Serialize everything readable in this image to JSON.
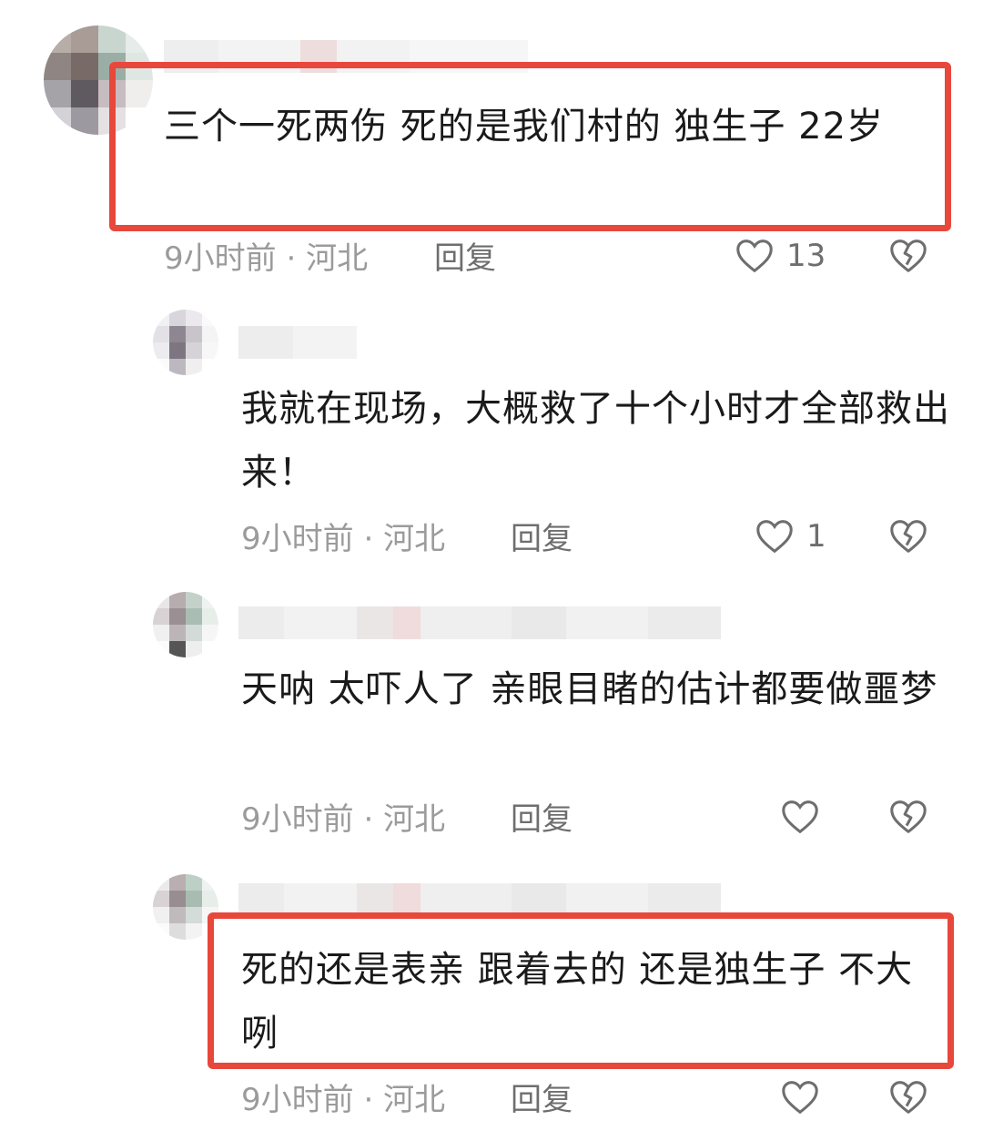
{
  "comments": [
    {
      "text": "三个一死两伤 死的是我们村的 独生子 22岁",
      "time": "9小时前",
      "location": "河北",
      "reply_label": "回复",
      "like_count": "13",
      "like_icon": "heart-outline-icon",
      "dislike_icon": "broken-heart-icon",
      "highlighted": true
    },
    {
      "text": "我就在现场，大概救了十个小时才全部救出来！",
      "time": "9小时前",
      "location": "河北",
      "reply_label": "回复",
      "like_count": "1",
      "highlighted": false
    },
    {
      "text": "天呐 太吓人了 亲眼目睹的估计都要做噩梦",
      "time": "9小时前",
      "location": "河北",
      "reply_label": "回复",
      "like_count": "",
      "highlighted": false
    },
    {
      "text": "死的还是表亲 跟着去的 还是独生子 不大咧",
      "time": "9小时前",
      "location": "河北",
      "reply_label": "回复",
      "like_count": "",
      "highlighted": true
    }
  ],
  "meta_separator": "·",
  "colors": {
    "highlight_border": "#e8473c",
    "comment_text": "#1a1a1a",
    "meta_text": "#9b9b9b"
  }
}
